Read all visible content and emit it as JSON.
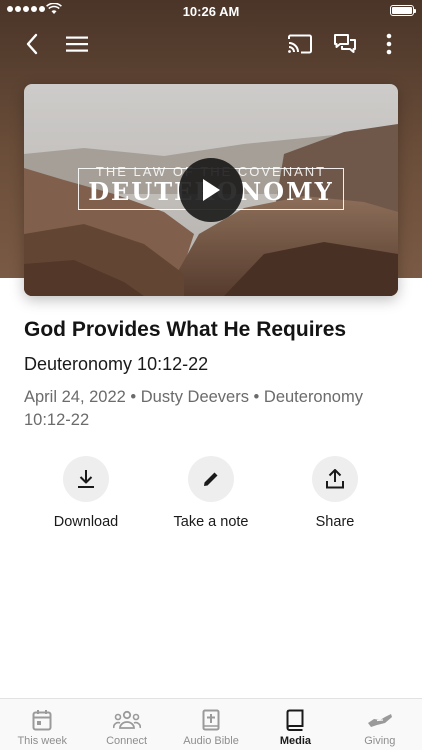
{
  "status_bar": {
    "time": "10:26 AM"
  },
  "nav": {
    "back_icon": "chevron-left-icon",
    "menu_icon": "hamburger-menu-icon",
    "cast_icon": "cast-icon",
    "chat_icon": "chat-bubbles-icon",
    "more_icon": "more-vertical-icon"
  },
  "video": {
    "overlay_top": "THE LAW OF THE COVENANT",
    "overlay_main": "DEUTERONOMY",
    "play_icon": "play-icon"
  },
  "sermon": {
    "title": "God Provides What He Requires",
    "reference": "Deuteronomy 10:12-22",
    "meta": "April 24, 2022 • Dusty Deevers • Deuteronomy 10:12-22"
  },
  "actions": [
    {
      "label": "Download",
      "icon": "download-icon"
    },
    {
      "label": "Take a note",
      "icon": "pencil-icon"
    },
    {
      "label": "Share",
      "icon": "share-icon"
    }
  ],
  "tabs": [
    {
      "label": "This week",
      "icon": "calendar-icon"
    },
    {
      "label": "Connect",
      "icon": "people-icon"
    },
    {
      "label": "Audio Bible",
      "icon": "bible-plus-icon"
    },
    {
      "label": "Media",
      "icon": "book-icon",
      "active": true
    },
    {
      "label": "Giving",
      "icon": "giving-hand-icon"
    }
  ],
  "colors": {
    "header_background": "#5a4232",
    "accent": "#1a1a1a",
    "muted_text": "#6b6b6b"
  }
}
